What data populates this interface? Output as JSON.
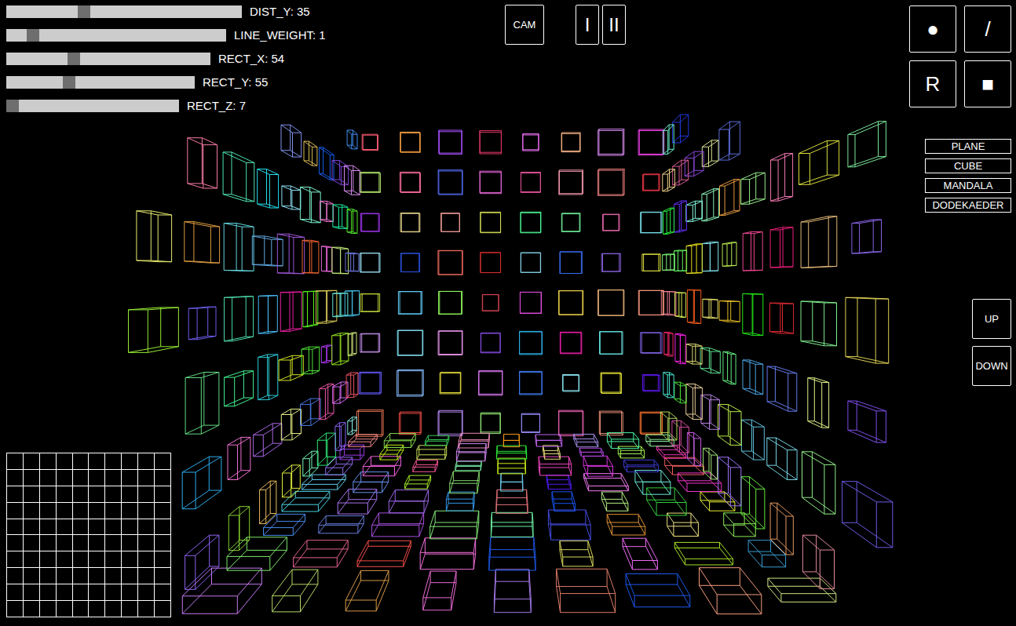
{
  "sliders": [
    {
      "label": "DIST_Y: 35",
      "level": 0.32
    },
    {
      "label": "LINE_WEIGHT: 1",
      "level": 0.1
    },
    {
      "label": "RECT_X: 54",
      "level": 0.32
    },
    {
      "label": "RECT_Y: 55",
      "level": 0.32
    },
    {
      "label": "RECT_Z: 7",
      "level": 0.0
    }
  ],
  "view_buttons": [
    "CAM",
    "I",
    "II"
  ],
  "tool_buttons": [
    "●",
    "/",
    "R",
    "■"
  ],
  "shape_buttons": [
    "PLANE",
    "CUBE",
    "MANDALA",
    "DODEKAEDER"
  ],
  "camera_buttons": [
    "UP",
    "DOWN"
  ]
}
